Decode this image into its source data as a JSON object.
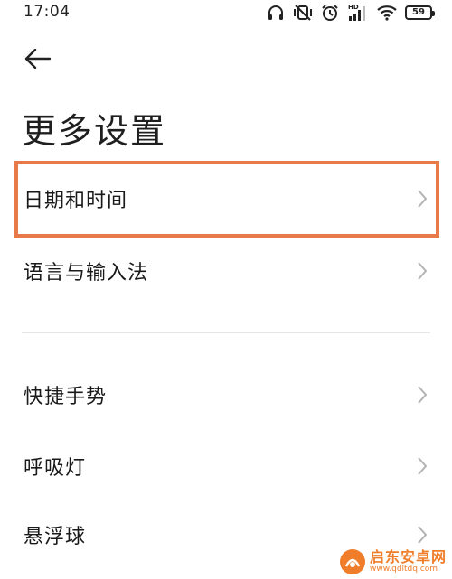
{
  "status_bar": {
    "time": "17:04",
    "hd_label": "HD",
    "battery_level": "59",
    "icons": [
      "headphones-icon",
      "muted-vibrate-icon",
      "alarm-icon",
      "signal-icon",
      "wifi-icon",
      "battery-icon"
    ]
  },
  "header": {
    "back_icon": "arrow-left-icon",
    "title": "更多设置"
  },
  "settings": {
    "items": [
      {
        "label": "日期和时间",
        "icon": "chevron-right-icon"
      },
      {
        "label": "语言与输入法",
        "icon": "chevron-right-icon"
      },
      {
        "label": "快捷手势",
        "icon": "chevron-right-icon"
      },
      {
        "label": "呼吸灯",
        "icon": "chevron-right-icon"
      },
      {
        "label": "悬浮球",
        "icon": "chevron-right-icon"
      }
    ]
  },
  "annotation": {
    "highlight_color": "#e87a4a"
  },
  "watermark": {
    "name": "启东安卓网",
    "url": "www.qdltdq.com",
    "color": "#f07d2a"
  }
}
